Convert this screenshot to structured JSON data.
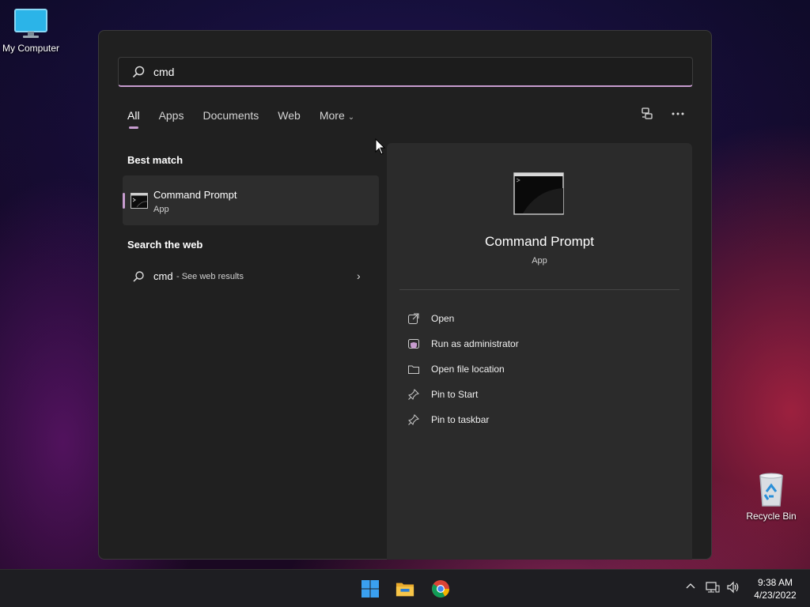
{
  "desktop": {
    "icons": [
      {
        "label": "My Computer"
      },
      {
        "label": "Recycle Bin"
      }
    ]
  },
  "search": {
    "value": "cmd",
    "placeholder": ""
  },
  "filters": {
    "items": [
      {
        "label": "All",
        "active": true
      },
      {
        "label": "Apps"
      },
      {
        "label": "Documents"
      },
      {
        "label": "Web"
      },
      {
        "label": "More"
      }
    ]
  },
  "best_match": {
    "title": "Best match",
    "name": "Command Prompt",
    "type": "App"
  },
  "search_web": {
    "title": "Search the web",
    "query": "cmd",
    "suffix": "- See web results"
  },
  "preview": {
    "name": "Command Prompt",
    "type": "App",
    "actions": [
      {
        "label": "Open",
        "icon": "open-icon"
      },
      {
        "label": "Run as administrator",
        "icon": "shield-window-icon"
      },
      {
        "label": "Open file location",
        "icon": "folder-icon"
      },
      {
        "label": "Pin to Start",
        "icon": "pin-icon"
      },
      {
        "label": "Pin to taskbar",
        "icon": "pin-icon"
      }
    ]
  },
  "taskbar": {
    "time": "9:38 AM",
    "date": "4/23/2022"
  },
  "colors": {
    "accent": "#c79ccf",
    "panel": "#202020",
    "preview": "#2b2b2b"
  }
}
